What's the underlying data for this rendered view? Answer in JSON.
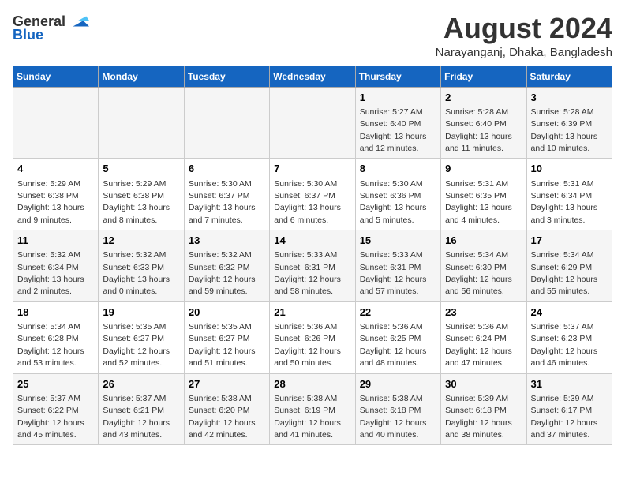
{
  "logo": {
    "general": "General",
    "blue": "Blue"
  },
  "title": "August 2024",
  "subtitle": "Narayanganj, Dhaka, Bangladesh",
  "weekdays": [
    "Sunday",
    "Monday",
    "Tuesday",
    "Wednesday",
    "Thursday",
    "Friday",
    "Saturday"
  ],
  "weeks": [
    [
      {
        "day": "",
        "info": ""
      },
      {
        "day": "",
        "info": ""
      },
      {
        "day": "",
        "info": ""
      },
      {
        "day": "",
        "info": ""
      },
      {
        "day": "1",
        "info": "Sunrise: 5:27 AM\nSunset: 6:40 PM\nDaylight: 13 hours\nand 12 minutes."
      },
      {
        "day": "2",
        "info": "Sunrise: 5:28 AM\nSunset: 6:40 PM\nDaylight: 13 hours\nand 11 minutes."
      },
      {
        "day": "3",
        "info": "Sunrise: 5:28 AM\nSunset: 6:39 PM\nDaylight: 13 hours\nand 10 minutes."
      }
    ],
    [
      {
        "day": "4",
        "info": "Sunrise: 5:29 AM\nSunset: 6:38 PM\nDaylight: 13 hours\nand 9 minutes."
      },
      {
        "day": "5",
        "info": "Sunrise: 5:29 AM\nSunset: 6:38 PM\nDaylight: 13 hours\nand 8 minutes."
      },
      {
        "day": "6",
        "info": "Sunrise: 5:30 AM\nSunset: 6:37 PM\nDaylight: 13 hours\nand 7 minutes."
      },
      {
        "day": "7",
        "info": "Sunrise: 5:30 AM\nSunset: 6:37 PM\nDaylight: 13 hours\nand 6 minutes."
      },
      {
        "day": "8",
        "info": "Sunrise: 5:30 AM\nSunset: 6:36 PM\nDaylight: 13 hours\nand 5 minutes."
      },
      {
        "day": "9",
        "info": "Sunrise: 5:31 AM\nSunset: 6:35 PM\nDaylight: 13 hours\nand 4 minutes."
      },
      {
        "day": "10",
        "info": "Sunrise: 5:31 AM\nSunset: 6:34 PM\nDaylight: 13 hours\nand 3 minutes."
      }
    ],
    [
      {
        "day": "11",
        "info": "Sunrise: 5:32 AM\nSunset: 6:34 PM\nDaylight: 13 hours\nand 2 minutes."
      },
      {
        "day": "12",
        "info": "Sunrise: 5:32 AM\nSunset: 6:33 PM\nDaylight: 13 hours\nand 0 minutes."
      },
      {
        "day": "13",
        "info": "Sunrise: 5:32 AM\nSunset: 6:32 PM\nDaylight: 12 hours\nand 59 minutes."
      },
      {
        "day": "14",
        "info": "Sunrise: 5:33 AM\nSunset: 6:31 PM\nDaylight: 12 hours\nand 58 minutes."
      },
      {
        "day": "15",
        "info": "Sunrise: 5:33 AM\nSunset: 6:31 PM\nDaylight: 12 hours\nand 57 minutes."
      },
      {
        "day": "16",
        "info": "Sunrise: 5:34 AM\nSunset: 6:30 PM\nDaylight: 12 hours\nand 56 minutes."
      },
      {
        "day": "17",
        "info": "Sunrise: 5:34 AM\nSunset: 6:29 PM\nDaylight: 12 hours\nand 55 minutes."
      }
    ],
    [
      {
        "day": "18",
        "info": "Sunrise: 5:34 AM\nSunset: 6:28 PM\nDaylight: 12 hours\nand 53 minutes."
      },
      {
        "day": "19",
        "info": "Sunrise: 5:35 AM\nSunset: 6:27 PM\nDaylight: 12 hours\nand 52 minutes."
      },
      {
        "day": "20",
        "info": "Sunrise: 5:35 AM\nSunset: 6:27 PM\nDaylight: 12 hours\nand 51 minutes."
      },
      {
        "day": "21",
        "info": "Sunrise: 5:36 AM\nSunset: 6:26 PM\nDaylight: 12 hours\nand 50 minutes."
      },
      {
        "day": "22",
        "info": "Sunrise: 5:36 AM\nSunset: 6:25 PM\nDaylight: 12 hours\nand 48 minutes."
      },
      {
        "day": "23",
        "info": "Sunrise: 5:36 AM\nSunset: 6:24 PM\nDaylight: 12 hours\nand 47 minutes."
      },
      {
        "day": "24",
        "info": "Sunrise: 5:37 AM\nSunset: 6:23 PM\nDaylight: 12 hours\nand 46 minutes."
      }
    ],
    [
      {
        "day": "25",
        "info": "Sunrise: 5:37 AM\nSunset: 6:22 PM\nDaylight: 12 hours\nand 45 minutes."
      },
      {
        "day": "26",
        "info": "Sunrise: 5:37 AM\nSunset: 6:21 PM\nDaylight: 12 hours\nand 43 minutes."
      },
      {
        "day": "27",
        "info": "Sunrise: 5:38 AM\nSunset: 6:20 PM\nDaylight: 12 hours\nand 42 minutes."
      },
      {
        "day": "28",
        "info": "Sunrise: 5:38 AM\nSunset: 6:19 PM\nDaylight: 12 hours\nand 41 minutes."
      },
      {
        "day": "29",
        "info": "Sunrise: 5:38 AM\nSunset: 6:18 PM\nDaylight: 12 hours\nand 40 minutes."
      },
      {
        "day": "30",
        "info": "Sunrise: 5:39 AM\nSunset: 6:18 PM\nDaylight: 12 hours\nand 38 minutes."
      },
      {
        "day": "31",
        "info": "Sunrise: 5:39 AM\nSunset: 6:17 PM\nDaylight: 12 hours\nand 37 minutes."
      }
    ]
  ]
}
